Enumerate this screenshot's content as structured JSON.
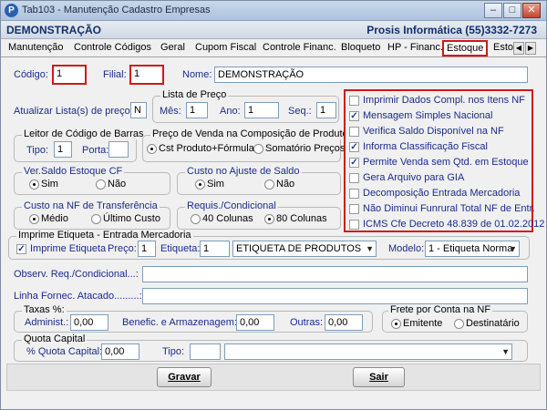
{
  "window": {
    "title": "Tab103 - Manutenção Cadastro Empresas",
    "app_icon": "P"
  },
  "header": {
    "company": "DEMONSTRAÇÃO",
    "brand": "Prosis Informática (55)3332-7273"
  },
  "tabs": [
    {
      "label": "Manutenção"
    },
    {
      "label": "Controle Códigos"
    },
    {
      "label": "Geral"
    },
    {
      "label": "Cupom Fiscal"
    },
    {
      "label": "Controle Financ."
    },
    {
      "label": "Bloqueto"
    },
    {
      "label": "HP - Financ."
    },
    {
      "label": "Estoque",
      "active": true
    },
    {
      "label": "Estoq"
    }
  ],
  "ids": {
    "codigo_label": "Código:",
    "codigo_value": "1",
    "filial_label": "Filial:",
    "filial_value": "1",
    "nome_label": "Nome:",
    "nome_value": "DEMONSTRAÇÃO"
  },
  "price_list": {
    "update_label": "Atualizar Lista(s) de preço:",
    "update_value": "N",
    "legend": "Lista de Preço",
    "mes_label": "Mês:",
    "mes_value": "1",
    "ano_label": "Ano:",
    "ano_value": "1",
    "seq_label": "Seq.:",
    "seq_value": "1"
  },
  "barcode": {
    "legend": "Leitor de Código de Barras",
    "tipo_label": "Tipo:",
    "tipo_value": "1",
    "porta_label": "Porta:",
    "porta_value": ""
  },
  "sale_price": {
    "legend": "Preço de Venda na Composição de Produtos",
    "options": [
      "Cst Produto+Fórmula",
      "Somatório Preços"
    ],
    "selected": 0
  },
  "stock_check": {
    "legend": "Ver.Saldo Estoque CF",
    "options": [
      "Sim",
      "Não"
    ],
    "selected": 0
  },
  "balance_cost": {
    "legend": "Custo no Ajuste de Saldo",
    "options": [
      "Sim",
      "Não"
    ],
    "selected": 0
  },
  "transfer_cost": {
    "legend": "Custo na NF de Transferência",
    "options": [
      "Médio",
      "Último Custo"
    ],
    "selected": 0
  },
  "requisition": {
    "legend": "Requis./Condicional",
    "options": [
      "40 Colunas",
      "80 Colunas"
    ],
    "selected": 1
  },
  "label_print": {
    "legend": "Imprime Etiqueta - Entrada Mercadoria",
    "checkbox_label": "Imprime Etiqueta",
    "checked": true,
    "preco_label": "Preço:",
    "preco_value": "1",
    "etiqueta_label": "Etiqueta:",
    "etiqueta_value": "1",
    "etiqueta_select": "ETIQUETA DE PRODUTOS",
    "modelo_label": "Modelo:",
    "modelo_select": "1 - Etiqueta Norma"
  },
  "notes": {
    "obs_label": "Observ. Req./Condicional...:",
    "obs_value": "",
    "linha_label": "Linha Fornec. Atacado.........:",
    "linha_value": ""
  },
  "taxes": {
    "legend": "Taxas %:",
    "adm_label": "Administ.:",
    "adm_value": "0,00",
    "benef_label": "Benefic. e Armazenagem:",
    "benef_value": "0,00",
    "outras_label": "Outras:",
    "outras_value": "0,00"
  },
  "freight": {
    "legend": "Frete por Conta na NF",
    "options": [
      "Emitente",
      "Destinatário"
    ],
    "selected": 0
  },
  "quota": {
    "legend": "Quota Capital",
    "percent_label": "% Quota Capital:",
    "percent_value": "0,00",
    "tipo_label": "Tipo:",
    "tipo_value": "",
    "tipo_select": ""
  },
  "options_list": [
    {
      "label": "Imprimir Dados Compl. nos Itens NF",
      "checked": false
    },
    {
      "label": "Mensagem Simples Nacional",
      "checked": true
    },
    {
      "label": "Verifica Saldo Disponível na NF",
      "checked": false
    },
    {
      "label": "Informa Classificação Fiscal",
      "checked": true
    },
    {
      "label": "Permite Venda sem Qtd. em Estoque",
      "checked": true
    },
    {
      "label": "Gera Arquivo para GIA",
      "checked": false
    },
    {
      "label": "Decomposição Entrada Mercadoria",
      "checked": false
    },
    {
      "label": "Não Diminui Funrural Total NF de Entr.",
      "checked": false
    },
    {
      "label": "ICMS Cfe Decreto 48.839 de 01.02.2012",
      "checked": false
    }
  ],
  "buttons": {
    "gravar": "Gravar",
    "sair": "Sair"
  },
  "colors": {
    "accent_red": "#d01818",
    "label_blue": "#1b2b8a",
    "header_blue": "#142f6b"
  },
  "icons": {
    "minimize": "minimize-icon",
    "maximize": "maximize-icon",
    "close": "close-icon",
    "tab_left": "chevron-left-icon",
    "tab_right": "chevron-right-icon",
    "dropdown": "chevron-down-icon"
  }
}
